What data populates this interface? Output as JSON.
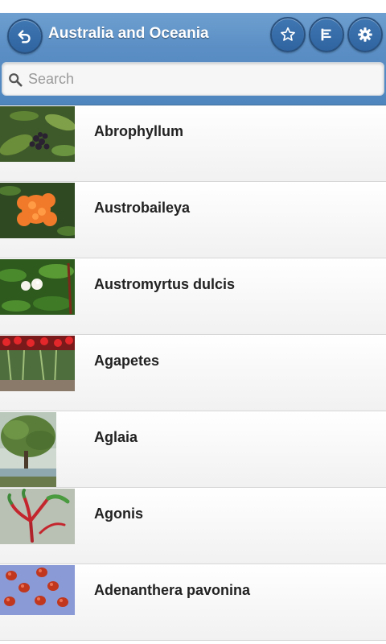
{
  "header": {
    "title": "Australia and Oceania",
    "back_icon": "back-arrow-icon",
    "favorites_icon": "star-icon",
    "sort_icon": "sort-list-icon",
    "settings_icon": "gear-icon",
    "accent_color": "#5a8ec4"
  },
  "search": {
    "placeholder": "Search",
    "value": ""
  },
  "plants": [
    {
      "name": "Abrophyllum",
      "thumbnail": "dark-berries-leaves"
    },
    {
      "name": "Austrobaileya",
      "thumbnail": "orange-flowers"
    },
    {
      "name": "Austromyrtus dulcis",
      "thumbnail": "white-berries-leaves"
    },
    {
      "name": "Agapetes",
      "thumbnail": "red-flowers-hanging"
    },
    {
      "name": "Aglaia",
      "thumbnail": "tree-landscape"
    },
    {
      "name": "Agonis",
      "thumbnail": "red-green-stems"
    },
    {
      "name": "Adenanthera pavonina",
      "thumbnail": "red-seeds"
    }
  ]
}
